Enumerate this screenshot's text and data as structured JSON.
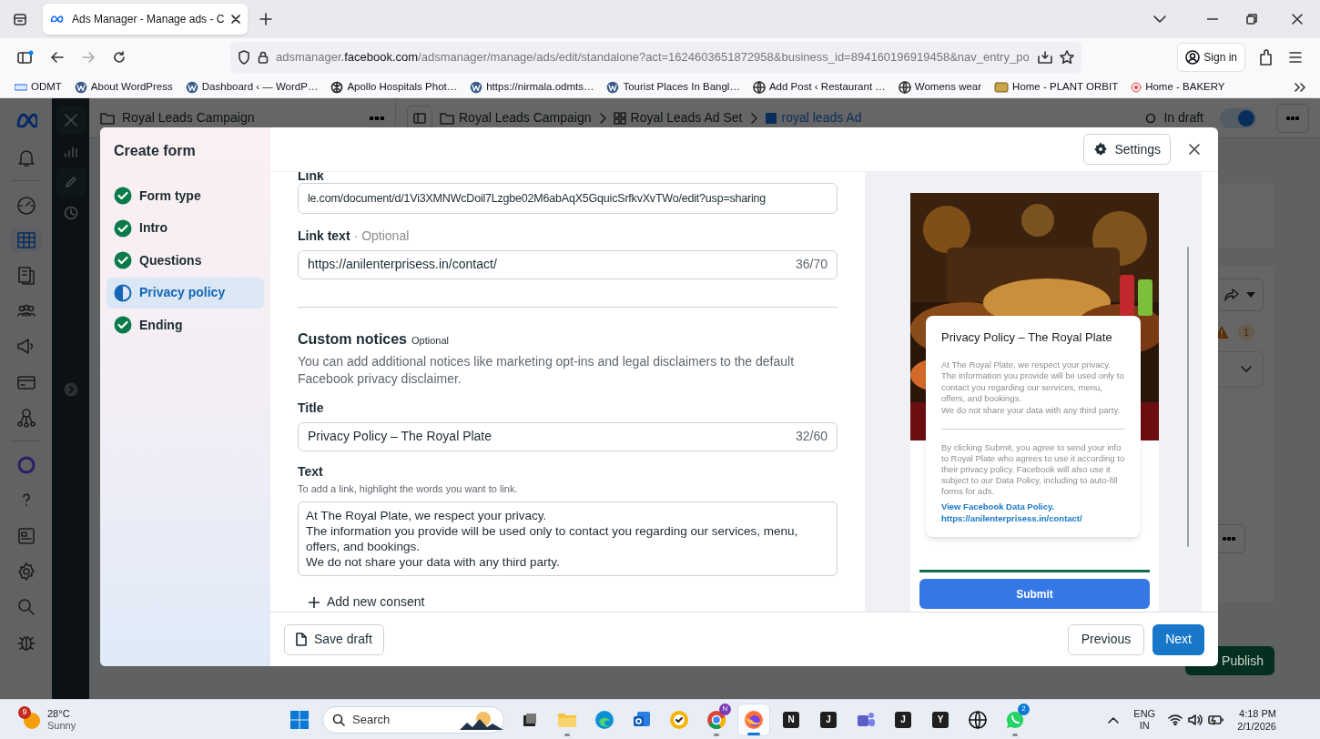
{
  "browser": {
    "tab_title": "Ads Manager - Manage ads - C",
    "url_host_prefix": "adsmanager.",
    "url_host": "facebook.com",
    "url_rest": "/adsmanager/manage/ads/edit/standalone?act=1624603651872958&business_id=894160196919458&nav_entry_po",
    "sign_in": "Sign in",
    "bookmarks": [
      {
        "label": "ODMT",
        "kind": "odmt"
      },
      {
        "label": "About WordPress",
        "kind": "wordpress"
      },
      {
        "label": "Dashboard ‹ — WordP…",
        "kind": "wordpress"
      },
      {
        "label": "Apollo Hospitals Phot…",
        "kind": "knot"
      },
      {
        "label": "https://nirmala.odmts…",
        "kind": "wordpress"
      },
      {
        "label": "Tourist Places In Bangl…",
        "kind": "wordpress"
      },
      {
        "label": "Add Post ‹ Restaurant …",
        "kind": "globe"
      },
      {
        "label": "Womens wear",
        "kind": "globe"
      },
      {
        "label": "Home - PLANT ORBIT",
        "kind": "plant"
      },
      {
        "label": "Home - BAKERY",
        "kind": "bakery"
      }
    ]
  },
  "app": {
    "campaign_title": "Royal Leads Campaign",
    "breadcrumbs": [
      {
        "label": "Royal Leads Campaign",
        "kind": "campaign"
      },
      {
        "label": "Royal Leads Ad Set",
        "kind": "adset"
      },
      {
        "label": "royal leads Ad",
        "kind": "ad"
      }
    ],
    "status": "In draft",
    "toggle_on": true,
    "warning_count": "1",
    "publish": "Publish"
  },
  "modal": {
    "title": "Create form",
    "steps": [
      {
        "label": "Form type",
        "completed": true,
        "selected": false
      },
      {
        "label": "Intro",
        "completed": true,
        "selected": false
      },
      {
        "label": "Questions",
        "completed": true,
        "selected": false
      },
      {
        "label": "Privacy policy",
        "completed": false,
        "selected": true
      },
      {
        "label": "Ending",
        "completed": true,
        "selected": false
      }
    ],
    "settings": "Settings",
    "link": {
      "label": "Link",
      "value": "le.com/document/d/1Vi3XMNWcDoil7Lzgbe02M6abAqX5GquicSrfkvXvTWo/edit?usp=sharing"
    },
    "link_text": {
      "label": "Link text",
      "optional": "· Optional",
      "value": "https://anilenterprisess.in/contact/",
      "count": "36/70"
    },
    "custom_notices": {
      "heading": "Custom notices",
      "optional": "Optional",
      "description": "You can add additional notices like marketing opt-ins and legal disclaimers to the default Facebook privacy disclaimer."
    },
    "title_field": {
      "label": "Title",
      "value": "Privacy Policy – The Royal Plate",
      "count": "32/60"
    },
    "text_field": {
      "label": "Text",
      "hint": "To add a link, highlight the words you want to link.",
      "value": "At The Royal Plate, we respect your privacy.\nThe information you provide will be used only to contact you regarding our services, menu, offers, and bookings.\nWe do not share your data with any third party."
    },
    "add_consent": "Add new consent",
    "footer": {
      "save_draft": "Save draft",
      "previous": "Previous",
      "next": "Next"
    },
    "preview": {
      "image": {
        "kind": "picture"
      },
      "card_title": "Privacy Policy – The Royal Plate",
      "card_body": "At The Royal Plate, we respect your privacy.\nThe information you provide will be used only to contact you regarding our services, menu, offers, and bookings.\nWe do not share your data with any third party.",
      "disclaimer": "By clicking Submit, you agree to send your info to Royal Plate who agrees to use it according to their privacy policy. Facebook will also use it subject to our Data Policy, including to auto-fill forms for ads.",
      "links": [
        "View Facebook Data Policy.",
        "https://anilenterprisess.in/contact/"
      ],
      "progress": {
        "level": 1
      },
      "submit": "Submit"
    }
  },
  "taskbar": {
    "weather": {
      "badge": "9",
      "temp": "28°C",
      "condition": "Sunny"
    },
    "search": "Search",
    "apps": [
      {
        "kind": "taskview",
        "running": false,
        "selected": false
      },
      {
        "kind": "files",
        "running": true,
        "selected": false
      },
      {
        "kind": "edge",
        "running": false,
        "selected": false
      },
      {
        "kind": "outlook",
        "running": false,
        "selected": false
      },
      {
        "kind": "norton",
        "running": false,
        "selected": false
      },
      {
        "kind": "chrome",
        "running": true,
        "selected": false,
        "badge": "N"
      },
      {
        "kind": "firefox",
        "running": true,
        "selected": true
      },
      {
        "kind": "letter",
        "letter": "N",
        "running": false,
        "selected": false
      },
      {
        "kind": "letter",
        "letter": "J",
        "running": false,
        "selected": false
      },
      {
        "kind": "teams",
        "running": false,
        "selected": false
      },
      {
        "kind": "letter",
        "letter": "J",
        "running": false,
        "selected": false
      },
      {
        "kind": "letter",
        "letter": "Y",
        "running": false,
        "selected": false
      },
      {
        "kind": "globe",
        "running": false,
        "selected": false
      },
      {
        "kind": "whatsapp",
        "running": true,
        "selected": false,
        "badge": "2"
      }
    ],
    "tray": {
      "lang": "ENG",
      "region": "IN",
      "time": "4:18 PM",
      "date": "2/1/2026"
    }
  }
}
